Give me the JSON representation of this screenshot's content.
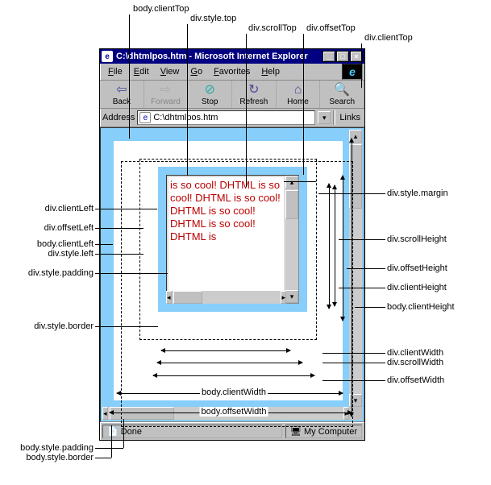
{
  "title": "C:\\dhtmlpos.htm - Microsoft Internet Explorer",
  "menu": {
    "file": "File",
    "edit": "Edit",
    "view": "View",
    "go": "Go",
    "fav": "Favorites",
    "help": "Help"
  },
  "toolbar": {
    "back": "Back",
    "forward": "Forward",
    "stop": "Stop",
    "refresh": "Refresh",
    "home": "Home",
    "search": "Search"
  },
  "addressbar": {
    "label": "Address",
    "value": "C:\\dhtmlpos.htm",
    "links": "Links"
  },
  "status": {
    "done": "Done",
    "zone": "My Computer"
  },
  "content_text": "is so cool! DHTML is so cool! DHTML is so cool! DHTML is so cool! DHTML is so cool! DHTML is",
  "labels": {
    "body_clientTop": "body.clientTop",
    "div_style_top": "div.style.top",
    "div_scrollTop": "div.scrollTop",
    "div_offsetTop": "div.offsetTop",
    "div_clientTop": "div.clientTop",
    "div_clientLeft": "div.clientLeft",
    "div_offsetLeft": "div.offsetLeft",
    "body_clientLeft": "body.clientLeft",
    "div_style_left": "div.style.left",
    "div_style_padding": "div.style.padding",
    "div_style_border": "div.style.border",
    "div_style_margin": "div.style.margin",
    "div_scrollHeight": "div.scrollHeight",
    "div_offsetHeight": "div.offsetHeight",
    "div_clientHeight": "div.clientHeight",
    "body_clientHeight": "body.clientHeight",
    "div_clientWidth": "div.clientWidth",
    "div_scrollWidth": "div.scrollWidth",
    "div_offsetWidth": "div.offsetWidth",
    "body_clientWidth": "body.clientWidth",
    "body_offsetWidth": "body.offsetWidth",
    "body_style_padding": "body.style.padding",
    "body_style_border": "body.style.border"
  }
}
